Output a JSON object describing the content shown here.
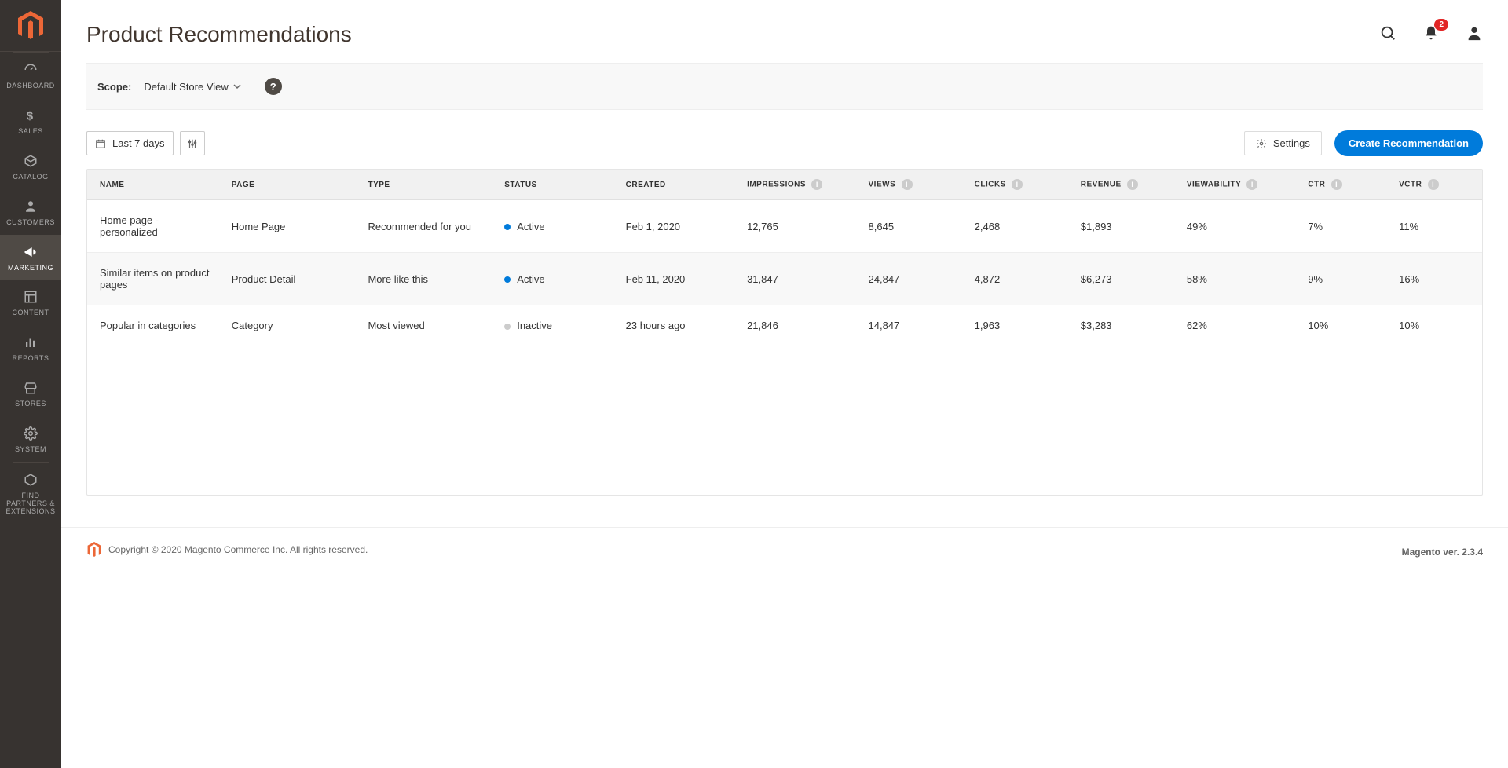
{
  "sidebar": {
    "items": [
      {
        "label": "DASHBOARD"
      },
      {
        "label": "SALES"
      },
      {
        "label": "CATALOG"
      },
      {
        "label": "CUSTOMERS"
      },
      {
        "label": "MARKETING"
      },
      {
        "label": "CONTENT"
      },
      {
        "label": "REPORTS"
      },
      {
        "label": "STORES"
      },
      {
        "label": "SYSTEM"
      },
      {
        "label": "FIND PARTNERS & EXTENSIONS"
      }
    ]
  },
  "header": {
    "title": "Product Recommendations",
    "notification_count": "2"
  },
  "scope": {
    "label": "Scope:",
    "value": "Default Store View"
  },
  "toolbar": {
    "date_range": "Last 7 days",
    "settings": "Settings",
    "create": "Create Recommendation"
  },
  "columns": [
    "Name",
    "Page",
    "Type",
    "Status",
    "Created",
    "Impressions",
    "Views",
    "Clicks",
    "Revenue",
    "Viewability",
    "CTR",
    "VCTR"
  ],
  "info_cols": [
    "Impressions",
    "Views",
    "Clicks",
    "Revenue",
    "Viewability",
    "CTR",
    "VCTR"
  ],
  "rows": [
    {
      "name": "Home page - personalized",
      "page": "Home Page",
      "type": "Recommended for you",
      "status": "Active",
      "status_class": "active",
      "created": "Feb 1, 2020",
      "impressions": "12,765",
      "views": "8,645",
      "clicks": "2,468",
      "revenue": "$1,893",
      "viewability": "49%",
      "ctr": "7%",
      "vctr": "11%"
    },
    {
      "name": "Similar items on product pages",
      "page": "Product Detail",
      "type": "More like this",
      "status": "Active",
      "status_class": "active",
      "created": "Feb 11, 2020",
      "impressions": "31,847",
      "views": "24,847",
      "clicks": "4,872",
      "revenue": "$6,273",
      "viewability": "58%",
      "ctr": "9%",
      "vctr": "16%"
    },
    {
      "name": "Popular in categories",
      "page": "Category",
      "type": "Most viewed",
      "status": "Inactive",
      "status_class": "inactive",
      "created": "23 hours ago",
      "impressions": "21,846",
      "views": "14,847",
      "clicks": "1,963",
      "revenue": "$3,283",
      "viewability": "62%",
      "ctr": "10%",
      "vctr": "10%"
    }
  ],
  "footer": {
    "copyright": "Copyright © 2020 Magento Commerce Inc. All rights reserved.",
    "version": "Magento ver. 2.3.4"
  }
}
